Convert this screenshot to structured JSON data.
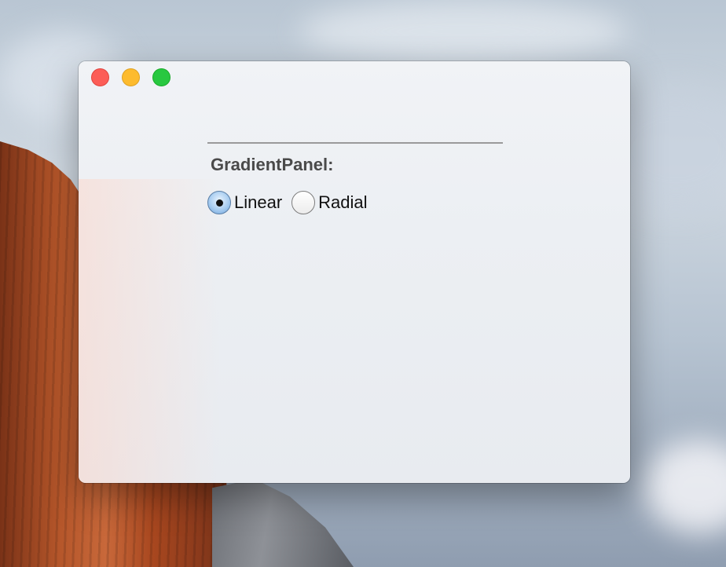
{
  "window": {
    "traffic_lights": {
      "close_color": "#fc5d57",
      "minimize_color": "#fdbb2e",
      "zoom_color": "#28c840"
    }
  },
  "panel": {
    "title": "GradientPanel:",
    "options": [
      {
        "label": "Linear",
        "selected": true
      },
      {
        "label": "Radial",
        "selected": false
      }
    ]
  }
}
